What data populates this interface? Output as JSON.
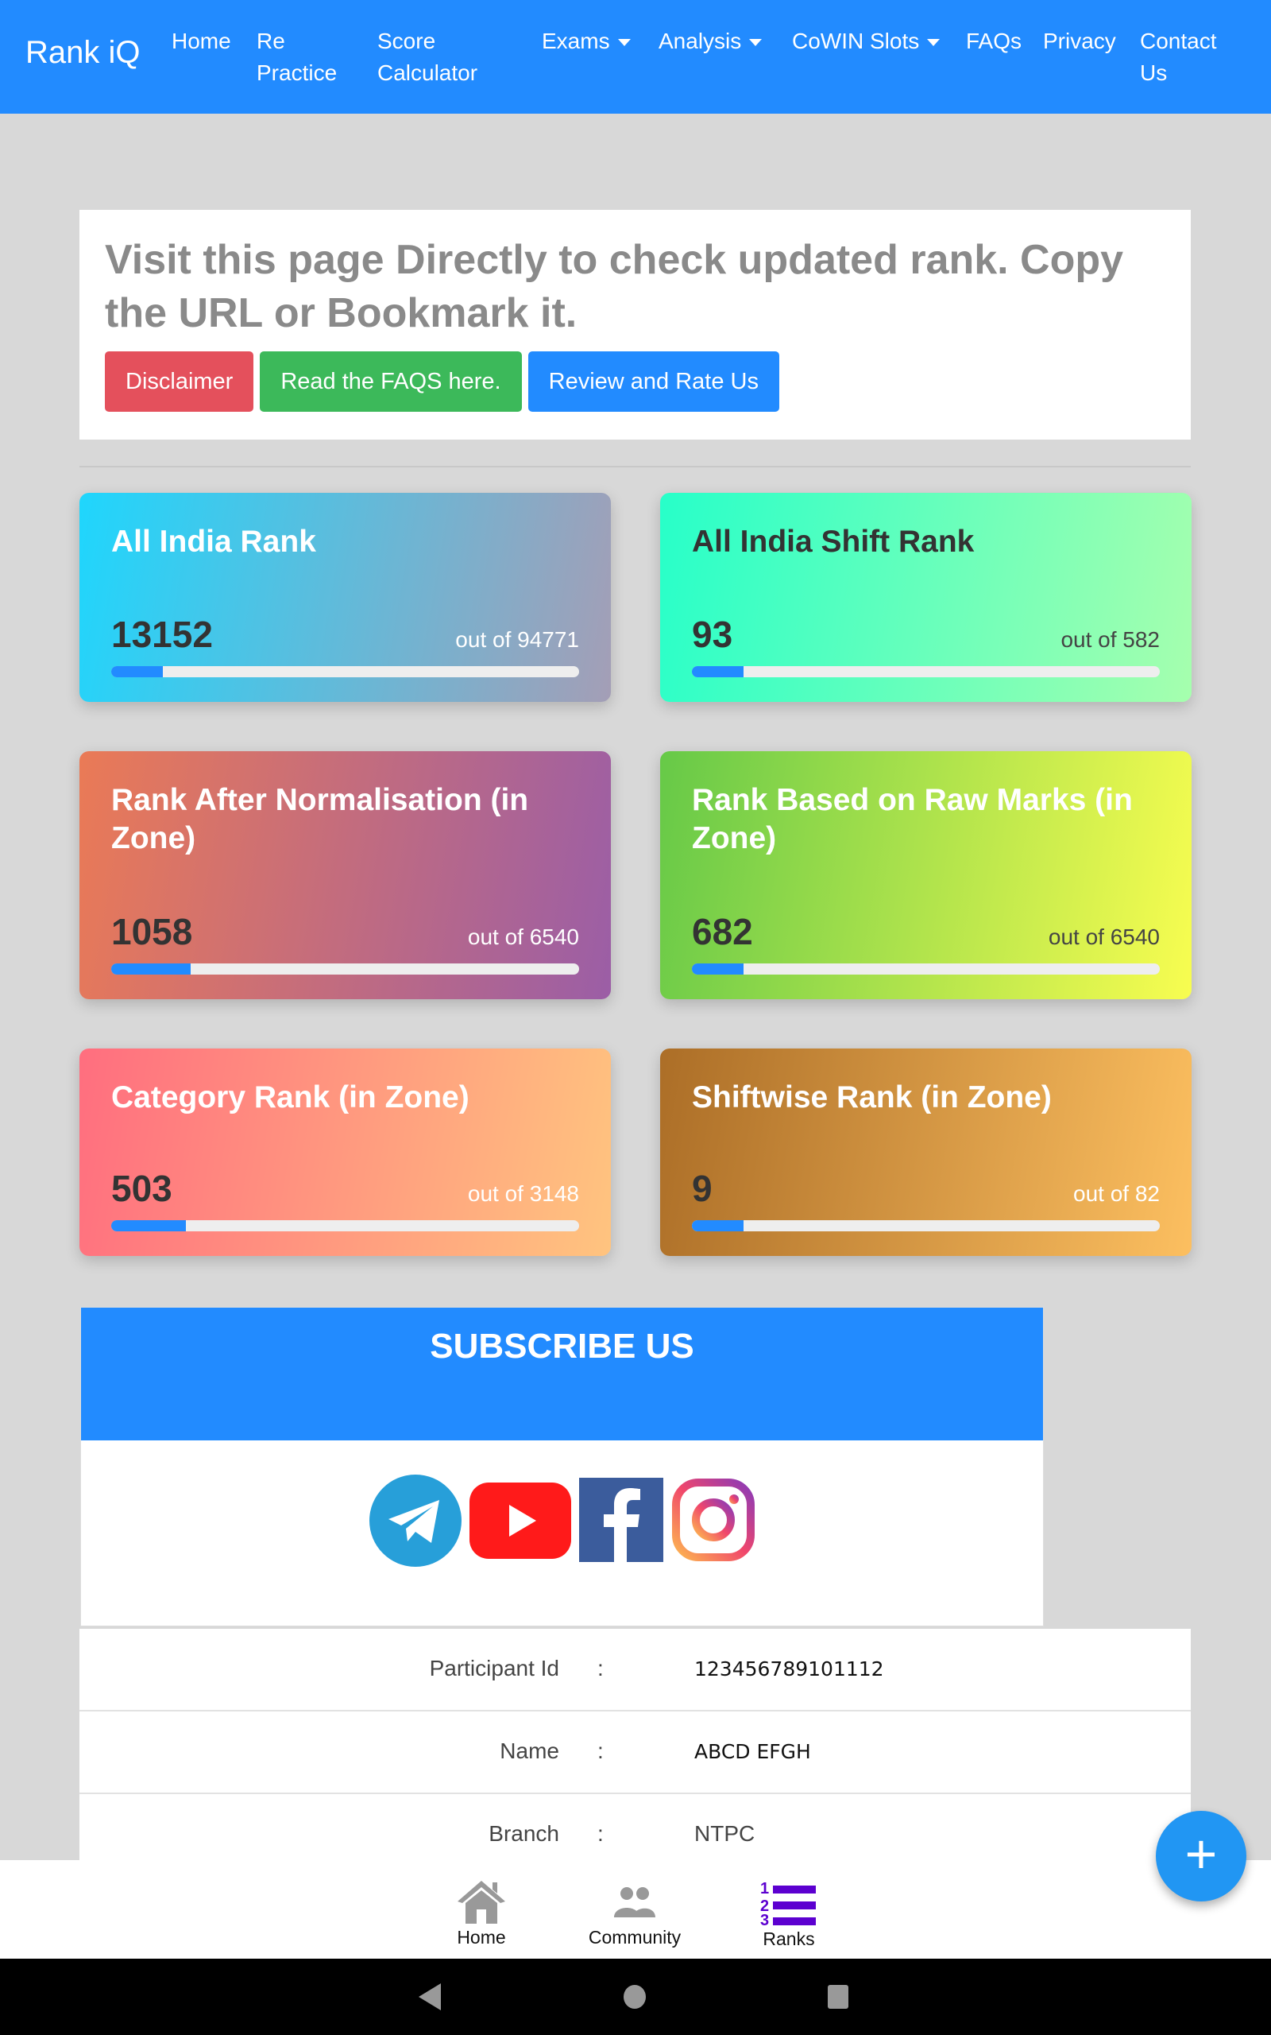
{
  "navbar": {
    "brand": "Rank iQ",
    "items": [
      {
        "label": "Home"
      },
      {
        "label": "Re Practice"
      },
      {
        "label": "Score Calculator"
      },
      {
        "label": "Exams"
      },
      {
        "label": "Analysis"
      },
      {
        "label": "CoWIN Slots"
      },
      {
        "label": "FAQs"
      },
      {
        "label": "Privacy"
      },
      {
        "label": "Contact Us"
      }
    ]
  },
  "notice": {
    "text": "Visit this page Directly to check updated rank. Copy the URL or Bookmark it.",
    "buttons": [
      {
        "label": "Disclaimer",
        "color": "#e4505c"
      },
      {
        "label": "Read the FAQS here.",
        "color": "#3cb95a"
      },
      {
        "label": "Review and Rate Us",
        "color": "#228bff"
      }
    ]
  },
  "ranks": [
    {
      "title": "All India Rank",
      "rank": "13152",
      "total": "out of 94771",
      "progress_pct": 11
    },
    {
      "title": "All India Shift Rank",
      "rank": "93",
      "total": "out of 582",
      "progress_pct": 11
    },
    {
      "title": "Rank After Normalisation (in Zone)",
      "rank": "1058",
      "total": "out of 6540",
      "progress_pct": 17
    },
    {
      "title": "Rank Based on Raw Marks (in Zone)",
      "rank": "682",
      "total": "out of 6540",
      "progress_pct": 11
    },
    {
      "title": "Category Rank (in Zone)",
      "rank": "503",
      "total": "out of 3148",
      "progress_pct": 16
    },
    {
      "title": "Shiftwise Rank (in Zone)",
      "rank": "9",
      "total": "out of 82",
      "progress_pct": 11
    }
  ],
  "subscribe": {
    "title": "SUBSCRIBE US",
    "icons": [
      "telegram-icon",
      "youtube-icon",
      "facebook-icon",
      "instagram-icon"
    ]
  },
  "info": [
    {
      "label": "Participant Id",
      "value": "123456789101112"
    },
    {
      "label": "Name",
      "value": "ABCD EFGH"
    },
    {
      "label": "Branch",
      "value": "NTPC"
    }
  ],
  "bottom_nav": [
    {
      "label": "Home"
    },
    {
      "label": "Community"
    },
    {
      "label": "Ranks"
    }
  ],
  "fab": "+",
  "colors": {
    "primary": "#228bff",
    "fab": "#2196f3",
    "ranks_icon": "#5c00d0"
  }
}
